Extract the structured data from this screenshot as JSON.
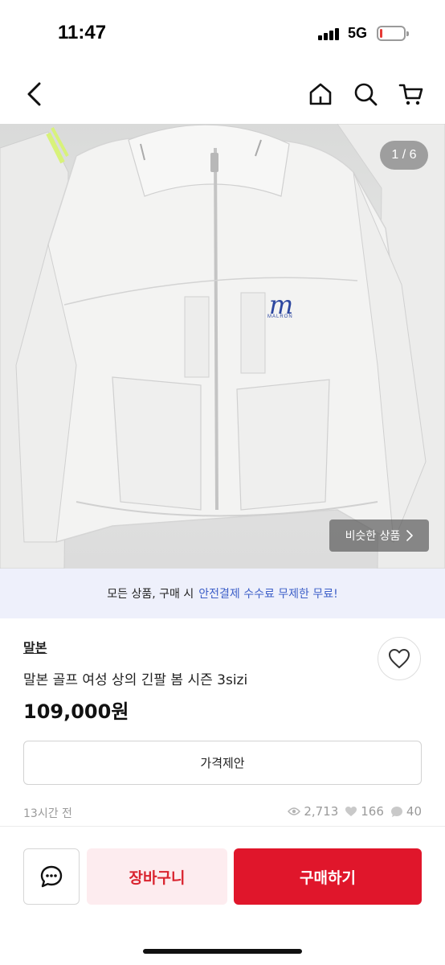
{
  "status_bar": {
    "time": "11:47",
    "network": "5G",
    "battery_level_percent": 12
  },
  "nav": {
    "back_icon": "chevron-left-icon",
    "home_icon": "home-icon",
    "search_icon": "search-icon",
    "cart_icon": "cart-icon"
  },
  "image": {
    "counter": "1 / 6",
    "brand_logo_text": "MALRON",
    "similar_button_label": "비슷한 상품"
  },
  "promo": {
    "text": "모든 상품, 구매 시",
    "highlight": "안전결제 수수료 무제한 무료!",
    "highlight_color": "#3d5fc8"
  },
  "product": {
    "shop_name": "말본",
    "title": "말본 골프 여성 상의 긴팔 봄 시즌 3sizi",
    "price": "109,000원",
    "offer_button_label": "가격제안",
    "posted_time": "13시간 전",
    "views": "2,713",
    "likes": "166",
    "chats": "40"
  },
  "actions": {
    "cart_label": "장바구니",
    "buy_label": "구매하기",
    "accent_color": "#e0162b"
  }
}
